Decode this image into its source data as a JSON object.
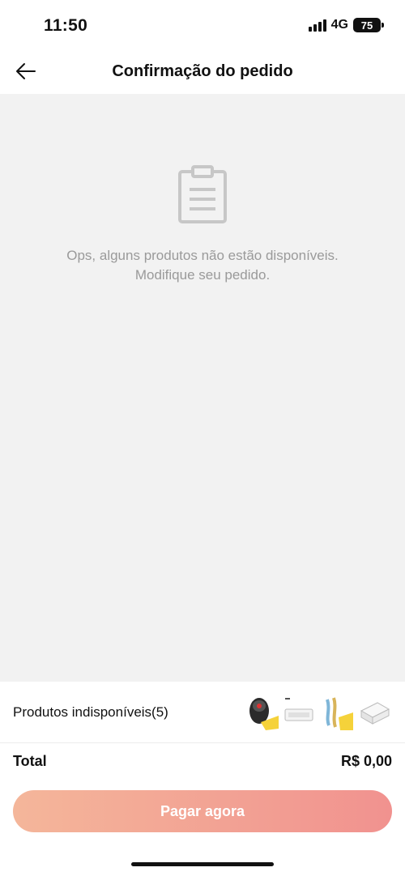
{
  "status_bar": {
    "time": "11:50",
    "network": "4G",
    "battery": "75"
  },
  "header": {
    "title": "Confirmação do pedido",
    "back_icon": "arrow-left-icon"
  },
  "main": {
    "empty_icon": "clipboard-icon",
    "message": "Ops, alguns produtos não estão disponíveis. Modifique seu pedido."
  },
  "unavailable": {
    "label": "Produtos indisponíveis(5)",
    "thumbnails": [
      "car-charger-thumbnail",
      "white-module-thumbnail",
      "cable-thumbnail",
      "white-adapter-thumbnail"
    ]
  },
  "total": {
    "label": "Total",
    "value": "R$ 0,00"
  },
  "pay_button": {
    "label": "Pagar agora"
  },
  "colors": {
    "accent_start": "#f4b69a",
    "accent_end": "#f1928f",
    "background_grey": "#f2f2f2"
  }
}
